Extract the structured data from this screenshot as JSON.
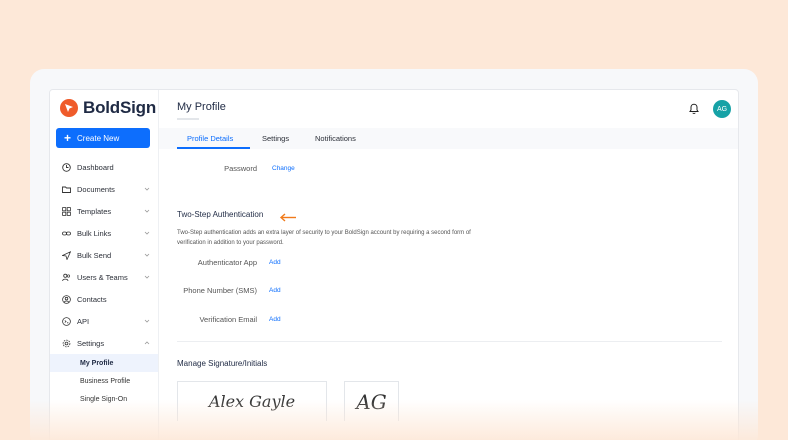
{
  "brand": {
    "name": "BoldSign",
    "accent": "#0d6efd",
    "logo_color": "#ef5b2a"
  },
  "sidebar": {
    "create_label": "Create New",
    "items": [
      {
        "label": "Dashboard",
        "icon": "dashboard-icon",
        "chevron": false
      },
      {
        "label": "Documents",
        "icon": "folder-icon",
        "chevron": true
      },
      {
        "label": "Templates",
        "icon": "templates-icon",
        "chevron": true
      },
      {
        "label": "Bulk Links",
        "icon": "link-icon",
        "chevron": true
      },
      {
        "label": "Bulk Send",
        "icon": "send-icon",
        "chevron": true
      },
      {
        "label": "Users & Teams",
        "icon": "users-icon",
        "chevron": true
      },
      {
        "label": "Contacts",
        "icon": "contacts-icon",
        "chevron": false
      },
      {
        "label": "API",
        "icon": "api-icon",
        "chevron": true
      },
      {
        "label": "Settings",
        "icon": "gear-icon",
        "chevron": true
      }
    ],
    "sub_items": [
      {
        "label": "My Profile",
        "active": true
      },
      {
        "label": "Business Profile",
        "active": false
      },
      {
        "label": "Single Sign-On",
        "active": false
      }
    ]
  },
  "header": {
    "title": "My Profile",
    "avatar_initials": "AG"
  },
  "tabs": [
    {
      "label": "Profile Details",
      "active": true
    },
    {
      "label": "Settings",
      "active": false
    },
    {
      "label": "Notifications",
      "active": false
    }
  ],
  "password": {
    "label": "Password",
    "action": "Change"
  },
  "two_step": {
    "title": "Two-Step Authentication",
    "description": "Two-Step authentication adds an extra layer of security to your BoldSign account by requiring a second form of verification in addition to your password.",
    "rows": [
      {
        "label": "Authenticator App",
        "action": "Add"
      },
      {
        "label": "Phone Number (SMS)",
        "action": "Add"
      },
      {
        "label": "Verification Email",
        "action": "Add"
      }
    ]
  },
  "signature": {
    "title": "Manage Signature/Initials",
    "signature_text": "Alex Gayle",
    "initials_text": "AG"
  }
}
